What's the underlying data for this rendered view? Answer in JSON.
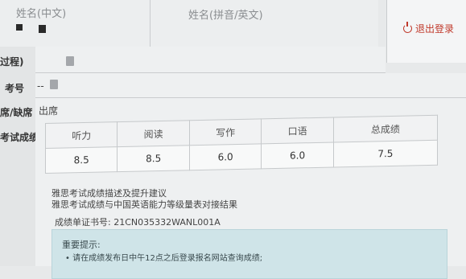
{
  "header": {
    "name_chinese_label": "姓名(中文)",
    "name_pinyin_label": "姓名(拼音/英文)",
    "logout_label": "退出登录"
  },
  "rows": {
    "process_label": "过程)",
    "candidate_number_label": "考号",
    "candidate_number_value": "--",
    "attendance_label": "席/缺席",
    "attendance_value": "出席",
    "results_label": "考试成绩"
  },
  "scores": {
    "headers": [
      "听力",
      "阅读",
      "写作",
      "口语",
      "总成绩"
    ],
    "values": [
      "8.5",
      "8.5",
      "6.0",
      "6.0",
      "7.5"
    ]
  },
  "links": {
    "description": "雅思考试成绩描述及提升建议",
    "cefr": "雅思考试成绩与中国英语能力等级量表对接结果"
  },
  "certificate": {
    "text": "成绩单证书号: 21CN035332WANL001A"
  },
  "notice": {
    "title": "重要提示:",
    "item": "• 请在成绩发布日中午12点之后登录报名网站查询成绩;"
  }
}
